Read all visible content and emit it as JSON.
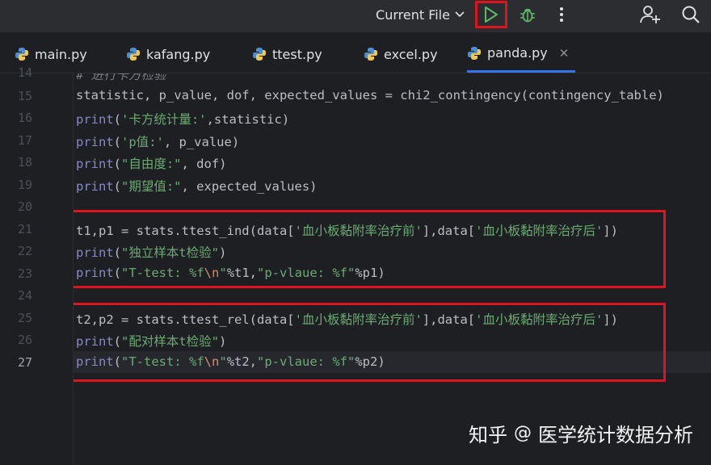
{
  "toolbar": {
    "run_config": "Current File",
    "icons": [
      "chevron-down-icon",
      "run-icon",
      "debug-icon",
      "more-vertical-icon",
      "add-user-icon",
      "search-icon"
    ]
  },
  "tabs": [
    {
      "label": "main.py",
      "active": false
    },
    {
      "label": "kafang.py",
      "active": false
    },
    {
      "label": "ttest.py",
      "active": false
    },
    {
      "label": "excel.py",
      "active": false
    },
    {
      "label": "panda.py",
      "active": true
    }
  ],
  "editor": {
    "current_line": "27",
    "line_numbers": [
      "14",
      "15",
      "16",
      "17",
      "18",
      "19",
      "20",
      "21",
      "22",
      "23",
      "24",
      "25",
      "26",
      "27"
    ],
    "lines": {
      "l14": "# 进行卡方检验",
      "l15": "statistic, p_value, dof, expected_values = chi2_contingency(contingency_table)",
      "l16_fn": "print",
      "l16_a": "(",
      "l16_s": "'卡方统计量:'",
      "l16_b": ",statistic)",
      "l17_fn": "print",
      "l17_a": "(",
      "l17_s": "'p值:'",
      "l17_b": ", p_value)",
      "l18_fn": "print",
      "l18_a": "(",
      "l18_s": "\"自由度:\"",
      "l18_b": ", dof)",
      "l19_fn": "print",
      "l19_a": "(",
      "l19_s": "\"期望值:\"",
      "l19_b": ", expected_values)",
      "l21_a": "t1,p1 = stats.ttest_ind(data[",
      "l21_s1": "'血小板黏附率治疗前'",
      "l21_b": "],data[",
      "l21_s2": "'血小板黏附率治疗后'",
      "l21_c": "])",
      "l22_fn": "print",
      "l22_a": "(",
      "l22_s": "\"独立样本t检验\"",
      "l22_b": ")",
      "l23_fn": "print",
      "l23_a": "(",
      "l23_s1": "\"T-test: %f",
      "l23_esc": "\\n",
      "l23_s2": "\"",
      "l23_b": "%t1,",
      "l23_s3": "\"p-vlaue: %f\"",
      "l23_c": "%p1)",
      "l25_a": "t2,p2 = stats.ttest_rel(data[",
      "l25_s1": "'血小板黏附率治疗前'",
      "l25_b": "],data[",
      "l25_s2": "'血小板黏附率治疗后'",
      "l25_c": "])",
      "l26_fn": "print",
      "l26_a": "(",
      "l26_s": "\"配对样本t检验\"",
      "l26_b": ")",
      "l27_fn": "print",
      "l27_a": "(",
      "l27_s1": "\"T-test: %f",
      "l27_esc": "\\n",
      "l27_s2": "\"",
      "l27_b": "%t2,",
      "l27_s3": "\"p-vlaue: %f\"",
      "l27_c": "%p2)"
    }
  },
  "watermark": {
    "site": "知乎",
    "sep": "@",
    "account": "医学统计数据分析"
  },
  "colors": {
    "accent": "#3574f0",
    "highlight_box": "#e0141e",
    "string": "#6aab73",
    "builtin": "#8888c6"
  }
}
